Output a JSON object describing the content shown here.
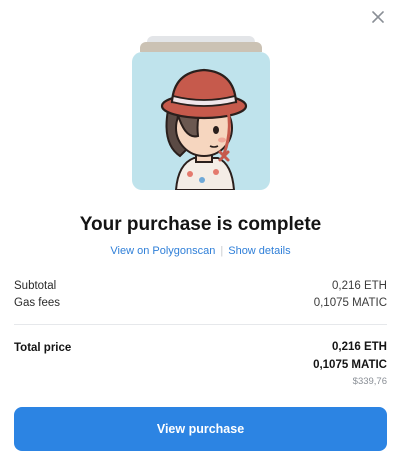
{
  "title": "Your purchase is complete",
  "links": {
    "polygonscan": "View on Polygonscan",
    "separator": "|",
    "details": "Show details"
  },
  "summary": {
    "subtotal_label": "Subtotal",
    "subtotal_value": "0,216 ETH",
    "gas_label": "Gas fees",
    "gas_value": "0,1075 MATIC"
  },
  "total": {
    "label": "Total price",
    "eth": "0,216 ETH",
    "matic": "0,1075 MATIC",
    "usd": "$339,76"
  },
  "button": {
    "label": "View purchase"
  },
  "icons": {
    "close": "close-icon"
  },
  "colors": {
    "accent": "#2c84e3",
    "link": "#2f7fd8",
    "nft_background": "#bfe3ec"
  }
}
